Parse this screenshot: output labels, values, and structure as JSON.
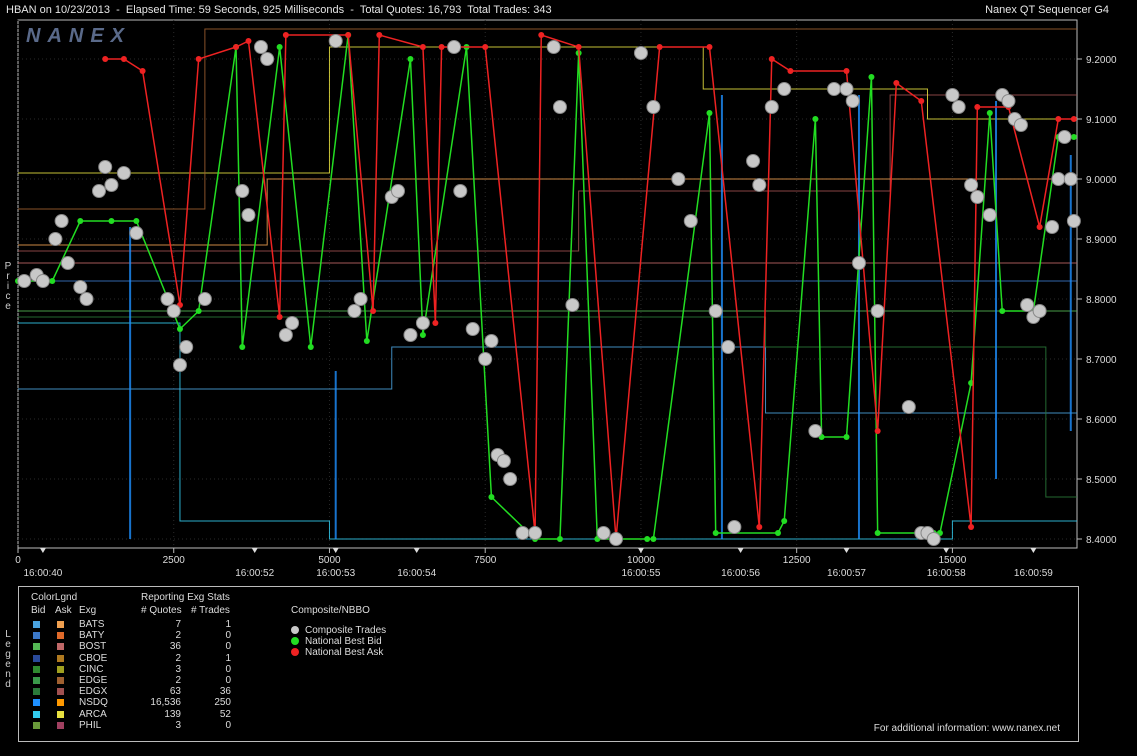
{
  "header": {
    "title": "HBAN on 10/23/2013  -  Elapsed Time: 59 Seconds, 925 Milliseconds  -  Total Quotes: 16,793  Total Trades: 343",
    "app": "Nanex QT Sequencer G4",
    "logo": "NANEX"
  },
  "axes": {
    "price_label": "Price",
    "legend_label": "Legend"
  },
  "chart_data": {
    "type": "line",
    "ylim": [
      8.385,
      9.265
    ],
    "xlim": [
      0,
      17000
    ],
    "y_ticks": [
      "9.2000",
      "9.1000",
      "9.0000",
      "8.9000",
      "8.8000",
      "8.7000",
      "8.6000",
      "8.5000",
      "8.4000"
    ],
    "y_tick_values": [
      9.2,
      9.1,
      9.0,
      8.9,
      8.8,
      8.7,
      8.6,
      8.5,
      8.4
    ],
    "x_ticks": [
      {
        "label": "0",
        "v": 0
      },
      {
        "label": "2500",
        "v": 2500
      },
      {
        "label": "5000",
        "v": 5000
      },
      {
        "label": "7500",
        "v": 7500
      },
      {
        "label": "10000",
        "v": 10000
      },
      {
        "label": "12500",
        "v": 12500
      },
      {
        "label": "15000",
        "v": 15000
      }
    ],
    "time_ticks": [
      {
        "label": "16:00:40",
        "v": 400
      },
      {
        "label": "16:00:52",
        "v": 3800
      },
      {
        "label": "16:00:53",
        "v": 5100
      },
      {
        "label": "16:00:54",
        "v": 6400
      },
      {
        "label": "16:00:55",
        "v": 10000
      },
      {
        "label": "16:00:56",
        "v": 11600
      },
      {
        "label": "16:00:57",
        "v": 13300
      },
      {
        "label": "16:00:58",
        "v": 14900
      },
      {
        "label": "16:00:59",
        "v": 16300
      }
    ],
    "series": [
      {
        "name": "National Best Bid",
        "color": "#22dd22",
        "points": [
          [
            0,
            8.83
          ],
          [
            550,
            8.83
          ],
          [
            1000,
            8.93
          ],
          [
            1500,
            8.93
          ],
          [
            1900,
            8.93
          ],
          [
            2600,
            8.75
          ],
          [
            2900,
            8.78
          ],
          [
            3500,
            9.22
          ],
          [
            3600,
            8.72
          ],
          [
            4200,
            9.22
          ],
          [
            4700,
            8.72
          ],
          [
            5300,
            9.24
          ],
          [
            5600,
            8.73
          ],
          [
            6300,
            9.2
          ],
          [
            6500,
            8.74
          ],
          [
            7200,
            9.22
          ],
          [
            7600,
            8.47
          ],
          [
            8200,
            8.41
          ],
          [
            8300,
            8.4
          ],
          [
            8700,
            8.4
          ],
          [
            9000,
            9.21
          ],
          [
            9300,
            8.4
          ],
          [
            10100,
            8.4
          ],
          [
            10200,
            8.4
          ],
          [
            11100,
            9.11
          ],
          [
            11200,
            8.41
          ],
          [
            12200,
            8.41
          ],
          [
            12300,
            8.43
          ],
          [
            12800,
            9.1
          ],
          [
            12900,
            8.57
          ],
          [
            13300,
            8.57
          ],
          [
            13700,
            9.17
          ],
          [
            13800,
            8.41
          ],
          [
            14700,
            8.41
          ],
          [
            14800,
            8.41
          ],
          [
            15300,
            8.66
          ],
          [
            15600,
            9.11
          ],
          [
            15800,
            8.78
          ],
          [
            16300,
            8.78
          ],
          [
            16700,
            9.07
          ],
          [
            16950,
            9.07
          ]
        ]
      },
      {
        "name": "National Best Ask",
        "color": "#ee2222",
        "points": [
          [
            1400,
            9.2
          ],
          [
            1700,
            9.2
          ],
          [
            2000,
            9.18
          ],
          [
            2600,
            8.79
          ],
          [
            2900,
            9.2
          ],
          [
            3500,
            9.22
          ],
          [
            3700,
            9.23
          ],
          [
            4200,
            8.77
          ],
          [
            4300,
            9.24
          ],
          [
            5300,
            9.24
          ],
          [
            5700,
            8.78
          ],
          [
            5800,
            9.24
          ],
          [
            6500,
            9.22
          ],
          [
            6700,
            8.76
          ],
          [
            6800,
            9.22
          ],
          [
            7500,
            9.22
          ],
          [
            8300,
            8.41
          ],
          [
            8400,
            9.24
          ],
          [
            9000,
            9.22
          ],
          [
            9600,
            8.4
          ],
          [
            10300,
            9.22
          ],
          [
            11100,
            9.22
          ],
          [
            11900,
            8.42
          ],
          [
            12100,
            9.2
          ],
          [
            12400,
            9.18
          ],
          [
            13300,
            9.18
          ],
          [
            13800,
            8.58
          ],
          [
            14100,
            9.16
          ],
          [
            14500,
            9.13
          ],
          [
            15300,
            8.42
          ],
          [
            15400,
            9.12
          ],
          [
            15900,
            9.12
          ],
          [
            16400,
            8.92
          ],
          [
            16700,
            9.1
          ],
          [
            16950,
            9.1
          ]
        ]
      },
      {
        "name": "Composite Trades",
        "color": "#c8c8c8",
        "points": [
          [
            100,
            8.83
          ],
          [
            300,
            8.84
          ],
          [
            400,
            8.83
          ],
          [
            600,
            8.9
          ],
          [
            700,
            8.93
          ],
          [
            800,
            8.86
          ],
          [
            1000,
            8.82
          ],
          [
            1100,
            8.8
          ],
          [
            1300,
            8.98
          ],
          [
            1400,
            9.02
          ],
          [
            1500,
            8.99
          ],
          [
            1700,
            9.01
          ],
          [
            1900,
            8.91
          ],
          [
            2400,
            8.8
          ],
          [
            2500,
            8.78
          ],
          [
            2600,
            8.69
          ],
          [
            2700,
            8.72
          ],
          [
            3000,
            8.8
          ],
          [
            3600,
            8.98
          ],
          [
            3700,
            8.94
          ],
          [
            3900,
            9.22
          ],
          [
            4000,
            9.2
          ],
          [
            4300,
            8.74
          ],
          [
            4400,
            8.76
          ],
          [
            5100,
            9.23
          ],
          [
            5400,
            8.78
          ],
          [
            5500,
            8.8
          ],
          [
            6000,
            8.97
          ],
          [
            6100,
            8.98
          ],
          [
            6300,
            8.74
          ],
          [
            6500,
            8.76
          ],
          [
            7000,
            9.22
          ],
          [
            7100,
            8.98
          ],
          [
            7300,
            8.75
          ],
          [
            7500,
            8.7
          ],
          [
            7600,
            8.73
          ],
          [
            7700,
            8.54
          ],
          [
            7800,
            8.53
          ],
          [
            7900,
            8.5
          ],
          [
            8100,
            8.41
          ],
          [
            8300,
            8.41
          ],
          [
            8600,
            9.22
          ],
          [
            8700,
            9.12
          ],
          [
            8900,
            8.79
          ],
          [
            9400,
            8.41
          ],
          [
            9600,
            8.4
          ],
          [
            10000,
            9.21
          ],
          [
            10200,
            9.12
          ],
          [
            10600,
            9.0
          ],
          [
            10800,
            8.93
          ],
          [
            11200,
            8.78
          ],
          [
            11400,
            8.72
          ],
          [
            11500,
            8.42
          ],
          [
            11800,
            9.03
          ],
          [
            11900,
            8.99
          ],
          [
            12100,
            9.12
          ],
          [
            12300,
            9.15
          ],
          [
            12800,
            8.58
          ],
          [
            13100,
            9.15
          ],
          [
            13300,
            9.15
          ],
          [
            13400,
            9.13
          ],
          [
            13500,
            8.86
          ],
          [
            13800,
            8.78
          ],
          [
            14300,
            8.62
          ],
          [
            14500,
            8.41
          ],
          [
            14600,
            8.41
          ],
          [
            14700,
            8.4
          ],
          [
            15000,
            9.14
          ],
          [
            15100,
            9.12
          ],
          [
            15300,
            8.99
          ],
          [
            15400,
            8.97
          ],
          [
            15600,
            8.94
          ],
          [
            15800,
            9.14
          ],
          [
            15900,
            9.13
          ],
          [
            16000,
            9.1
          ],
          [
            16100,
            9.09
          ],
          [
            16200,
            8.79
          ],
          [
            16300,
            8.77
          ],
          [
            16400,
            8.78
          ],
          [
            16600,
            8.92
          ],
          [
            16700,
            9.0
          ],
          [
            16800,
            9.07
          ],
          [
            16900,
            9.0
          ],
          [
            16950,
            8.93
          ]
        ]
      }
    ]
  },
  "legend": {
    "colorlgnd_title": "ColorLgnd",
    "col_bid": "Bid",
    "col_ask": "Ask",
    "col_exg": "Exg",
    "stats_title": "Reporting Exg Stats",
    "col_quotes": "# Quotes",
    "col_trades": "# Trades",
    "composite_title": "Composite/NBBO",
    "composite_items": [
      {
        "label": "Composite Trades",
        "color": "#c8c8c8"
      },
      {
        "label": "National Best Bid",
        "color": "#22dd22"
      },
      {
        "label": "National Best Ask",
        "color": "#ee2222"
      }
    ],
    "exchanges": [
      {
        "exg": "BATS",
        "quotes": "7",
        "trades": "1",
        "bid": "#4aa3df",
        "ask": "#f0a050"
      },
      {
        "exg": "BATY",
        "quotes": "2",
        "trades": "0",
        "bid": "#3b78c8",
        "ask": "#e06a2a"
      },
      {
        "exg": "BOST",
        "quotes": "36",
        "trades": "0",
        "bid": "#55b855",
        "ask": "#c06868"
      },
      {
        "exg": "CBOE",
        "quotes": "2",
        "trades": "1",
        "bid": "#2a4a9a",
        "ask": "#b07a20"
      },
      {
        "exg": "CINC",
        "quotes": "3",
        "trades": "0",
        "bid": "#2f8a2f",
        "ask": "#a0a020"
      },
      {
        "exg": "EDGE",
        "quotes": "2",
        "trades": "0",
        "bid": "#3a9a4a",
        "ask": "#a06030"
      },
      {
        "exg": "EDGX",
        "quotes": "63",
        "trades": "36",
        "bid": "#2a7a3a",
        "ask": "#a05050"
      },
      {
        "exg": "NSDQ",
        "quotes": "16,536",
        "trades": "250",
        "bid": "#1e90ff",
        "ask": "#ff9900"
      },
      {
        "exg": "ARCA",
        "quotes": "139",
        "trades": "52",
        "bid": "#33ccee",
        "ask": "#e8e040"
      },
      {
        "exg": "PHIL",
        "quotes": "3",
        "trades": "0",
        "bid": "#6a9a3a",
        "ask": "#a04060"
      }
    ],
    "footer": "For additional information: www.nanex.net"
  }
}
